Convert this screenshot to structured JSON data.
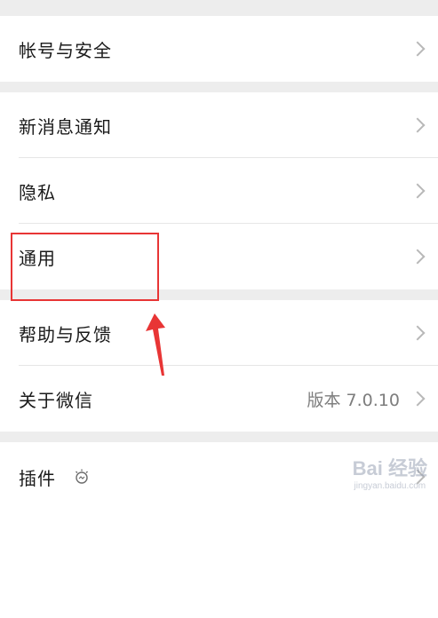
{
  "settings": {
    "groups": [
      {
        "items": [
          {
            "label": "帐号与安全"
          }
        ]
      },
      {
        "items": [
          {
            "label": "新消息通知"
          },
          {
            "label": "隐私"
          },
          {
            "label": "通用"
          }
        ]
      },
      {
        "items": [
          {
            "label": "帮助与反馈"
          },
          {
            "label": "关于微信",
            "value": "版本 7.0.10"
          }
        ]
      },
      {
        "items": [
          {
            "label": "插件",
            "icon": "bulb-icon"
          }
        ]
      }
    ]
  },
  "annotations": {
    "highlight_color": "#e83535",
    "highlighted_item": "通用"
  },
  "watermark": {
    "main": "Bai 经验",
    "sub": "jingyan.baidu.com"
  },
  "colors": {
    "background": "#ededed",
    "row": "#ffffff",
    "chevron": "#b8b8b8",
    "accent_red": "#e83535"
  }
}
